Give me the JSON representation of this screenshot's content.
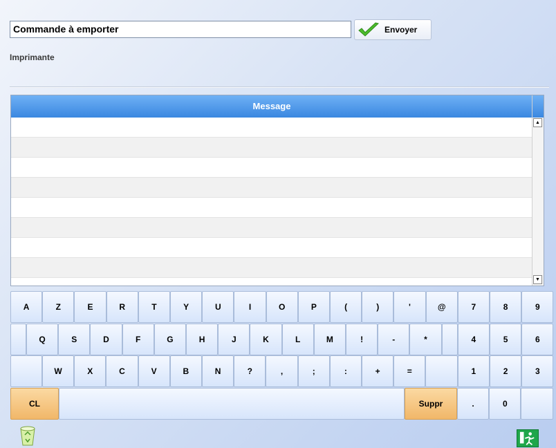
{
  "order": {
    "title": "Commande à emporter"
  },
  "send_button": {
    "label": "Envoyer"
  },
  "printer": {
    "label": "Imprimante"
  },
  "grid": {
    "header": "Message",
    "row_count": 8
  },
  "keyboard": {
    "row1": [
      "A",
      "Z",
      "E",
      "R",
      "T",
      "Y",
      "U",
      "I",
      "O",
      "P",
      "(",
      ")",
      "'",
      "@",
      "7",
      "8",
      "9"
    ],
    "row2": [
      "Q",
      "S",
      "D",
      "F",
      "G",
      "H",
      "J",
      "K",
      "L",
      "M",
      "!",
      "-",
      "*",
      "",
      "4",
      "5",
      "6"
    ],
    "row3": [
      "",
      "W",
      "X",
      "C",
      "V",
      "B",
      "N",
      "?",
      ",",
      ";",
      ":",
      "+",
      "=",
      "",
      "1",
      "2",
      "3"
    ],
    "row4": {
      "clear": "CL",
      "space": "",
      "delete": "Suppr",
      "dot": ".",
      "zero": "0",
      "blank": ""
    }
  },
  "icons": {
    "send": "check-icon",
    "trash": "recycle-bin-icon",
    "exit": "exit-icon"
  },
  "colors": {
    "accent": "#3a87e0",
    "orange_key": "#f1b769",
    "exit_green": "#1fa64a"
  }
}
